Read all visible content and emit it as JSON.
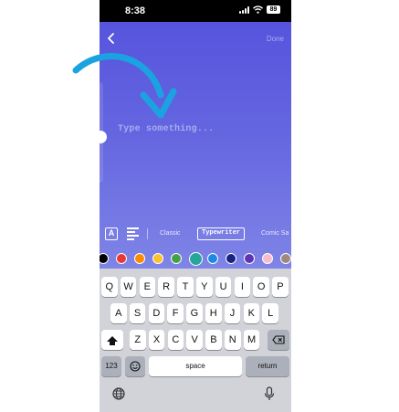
{
  "status_bar": {
    "time": "8:38",
    "battery": "89"
  },
  "editor": {
    "done_label": "Done",
    "placeholder": "Type something...",
    "font_style_glyph": "A"
  },
  "font_tabs": [
    "Classic",
    "Typewriter",
    "Comic Sa"
  ],
  "selected_font": "Typewriter",
  "colors": [
    "#000000",
    "#e53935",
    "#fb8c00",
    "#f9c22e",
    "#43a047",
    "#26a69a",
    "#1e88e5",
    "#1a237e",
    "#5e35b1",
    "#f8bbd0",
    "#a1887f"
  ],
  "selected_color": "#26a69a",
  "keyboard": {
    "row1": [
      "Q",
      "W",
      "E",
      "R",
      "T",
      "Y",
      "U",
      "I",
      "O",
      "P"
    ],
    "row2": [
      "A",
      "S",
      "D",
      "F",
      "G",
      "H",
      "J",
      "K",
      "L"
    ],
    "row3": [
      "Z",
      "X",
      "C",
      "V",
      "B",
      "N",
      "M"
    ],
    "numbers_label": "123",
    "space_label": "space",
    "return_label": "return"
  },
  "accent_colors": {
    "canvas_top": "#5654dd",
    "canvas_bottom": "#7f84e6",
    "annotation_arrow": "#1aa3e0"
  }
}
